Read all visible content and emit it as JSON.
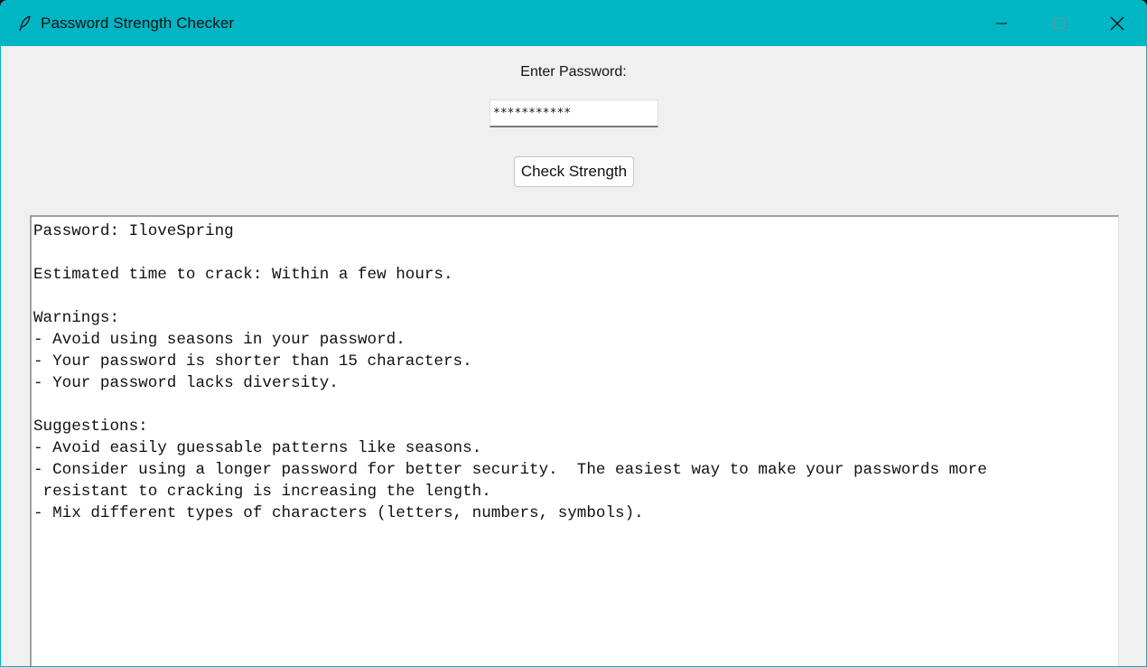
{
  "window": {
    "title": "Password Strength Checker",
    "accent": "#00b5c4"
  },
  "form": {
    "label": "Enter Password:",
    "password_masked": "***********",
    "button_label": "Check Strength"
  },
  "output": {
    "lines": [
      "Password: IloveSpring",
      "",
      "Estimated time to crack: Within a few hours.",
      "",
      "Warnings:",
      "- Avoid using seasons in your password.",
      "- Your password is shorter than 15 characters.",
      "- Your password lacks diversity.",
      "",
      "Suggestions:",
      "- Avoid easily guessable patterns like seasons.",
      "- Consider using a longer password for better security.  The easiest way to make your passwords more",
      " resistant to cracking is increasing the length.",
      "- Mix different types of characters (letters, numbers, symbols)."
    ]
  }
}
